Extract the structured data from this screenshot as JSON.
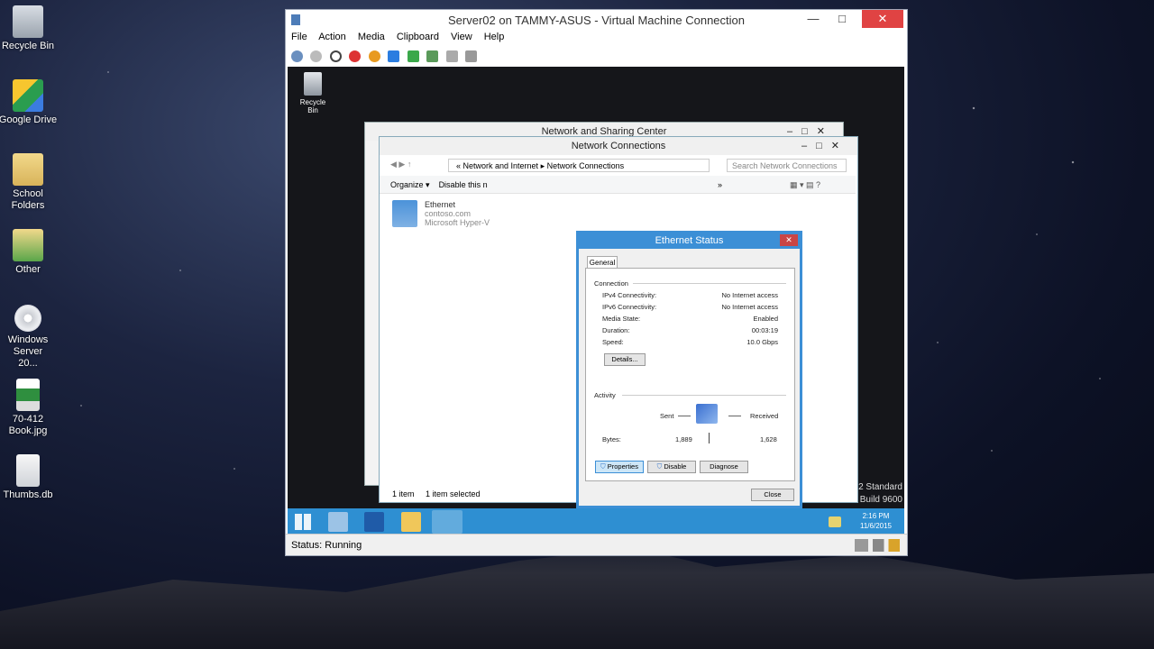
{
  "desktop": {
    "icons": [
      {
        "label": "Recycle Bin"
      },
      {
        "label": "Google Drive"
      },
      {
        "label": "School Folders"
      },
      {
        "label": "Other"
      },
      {
        "label": "Windows Server 20..."
      },
      {
        "label": "70-412 Book.jpg"
      },
      {
        "label": "Thumbs.db"
      }
    ]
  },
  "vm_window": {
    "title": "Server02 on TAMMY-ASUS - Virtual Machine Connection",
    "menu": [
      "File",
      "Action",
      "Media",
      "Clipboard",
      "View",
      "Help"
    ],
    "status": "Status: Running"
  },
  "guest": {
    "recycle_bin": "Recycle Bin",
    "watermark": [
      "2 Standard",
      "Build 9600"
    ],
    "clock": {
      "time": "2:16 PM",
      "date": "11/6/2015"
    },
    "nsc_title": "Network and Sharing Center",
    "nc": {
      "title": "Network Connections",
      "breadcrumb": [
        "Network and Internet",
        "Network Connections"
      ],
      "search_placeholder": "Search Network Connections",
      "organize": "Organize",
      "disable_this": "Disable this n",
      "more": "»",
      "item": {
        "name": "Ethernet",
        "domain": "contoso.com",
        "adapter": "Microsoft Hyper-V"
      },
      "status_left": "1 item",
      "status_right": "1 item selected"
    },
    "ethernet_status": {
      "title": "Ethernet Status",
      "tab": "General",
      "connection_label": "Connection",
      "rows": [
        {
          "label": "IPv4 Connectivity:",
          "value": "No Internet access"
        },
        {
          "label": "IPv6 Connectivity:",
          "value": "No Internet access"
        },
        {
          "label": "Media State:",
          "value": "Enabled"
        },
        {
          "label": "Duration:",
          "value": "00:03:19"
        },
        {
          "label": "Speed:",
          "value": "10.0 Gbps"
        }
      ],
      "details_btn": "Details...",
      "activity_label": "Activity",
      "sent": "Sent",
      "received": "Received",
      "bytes_label": "Bytes:",
      "bytes_sent": "1,889",
      "bytes_received": "1,628",
      "properties_btn": "Properties",
      "disable_btn": "Disable",
      "diagnose_btn": "Diagnose",
      "close_btn": "Close"
    }
  }
}
